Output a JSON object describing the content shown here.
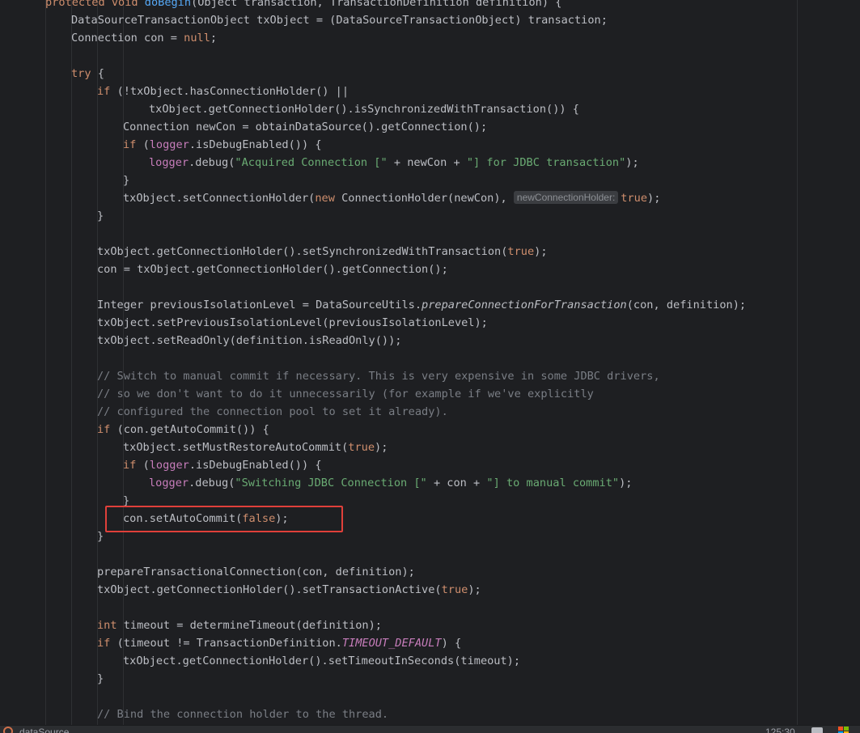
{
  "editor": {
    "lines": [
      [
        [
          "kw",
          "protected "
        ],
        [
          "kw",
          "void "
        ],
        [
          "method",
          "doBegin"
        ],
        [
          "plain",
          "(Object transaction, TransactionDefinition definition) {"
        ]
      ],
      [
        [
          "plain",
          "DataSourceTransactionObject txObject = (DataSourceTransactionObject) transaction;"
        ]
      ],
      [
        [
          "plain",
          "Connection con = "
        ],
        [
          "kw",
          "null"
        ],
        [
          "plain",
          ";"
        ]
      ],
      [],
      [
        [
          "kw",
          "try "
        ],
        [
          "plain",
          "{"
        ]
      ],
      [
        [
          "kw",
          "if "
        ],
        [
          "plain",
          "(!txObject.hasConnectionHolder() ||"
        ]
      ],
      [
        [
          "plain",
          "txObject.getConnectionHolder().isSynchronizedWithTransaction()) {"
        ]
      ],
      [
        [
          "plain",
          "Connection newCon = obtainDataSource().getConnection();"
        ]
      ],
      [
        [
          "kw",
          "if "
        ],
        [
          "plain",
          "("
        ],
        [
          "field",
          "logger"
        ],
        [
          "plain",
          ".isDebugEnabled()) {"
        ]
      ],
      [
        [
          "field",
          "logger"
        ],
        [
          "plain",
          ".debug("
        ],
        [
          "str",
          "\"Acquired Connection [\" "
        ],
        [
          "plain",
          "+ newCon + "
        ],
        [
          "str",
          "\"] for JDBC transaction\""
        ],
        [
          "plain",
          ");"
        ]
      ],
      [
        [
          "plain",
          "}"
        ]
      ],
      [
        [
          "plain",
          "txObject.setConnectionHolder("
        ],
        [
          "kw",
          "new "
        ],
        [
          "plain",
          "ConnectionHolder(newCon), "
        ],
        [
          "hint",
          "newConnectionHolder:"
        ],
        [
          "kw",
          "true"
        ],
        [
          "plain",
          ");"
        ]
      ],
      [
        [
          "plain",
          "}"
        ]
      ],
      [],
      [
        [
          "plain",
          "txObject.getConnectionHolder().setSynchronizedWithTransaction("
        ],
        [
          "kw",
          "true"
        ],
        [
          "plain",
          ");"
        ]
      ],
      [
        [
          "plain",
          "con = txObject.getConnectionHolder().getConnection();"
        ]
      ],
      [],
      [
        [
          "plain",
          "Integer previousIsolationLevel = DataSourceUtils."
        ],
        [
          "italic",
          "prepareConnectionForTransaction"
        ],
        [
          "plain",
          "(con, definition);"
        ]
      ],
      [
        [
          "plain",
          "txObject.setPreviousIsolationLevel(previousIsolationLevel);"
        ]
      ],
      [
        [
          "plain",
          "txObject.setReadOnly(definition.isReadOnly());"
        ]
      ],
      [],
      [
        [
          "cmt",
          "// Switch to manual commit if necessary. This is very expensive in some JDBC drivers,"
        ]
      ],
      [
        [
          "cmt",
          "// so we don't want to do it unnecessarily (for example if we've explicitly"
        ]
      ],
      [
        [
          "cmt",
          "// configured the connection pool to set it already)."
        ]
      ],
      [
        [
          "kw",
          "if "
        ],
        [
          "plain",
          "(con.getAutoCommit()) {"
        ]
      ],
      [
        [
          "plain",
          "txObject.setMustRestoreAutoCommit("
        ],
        [
          "kw",
          "true"
        ],
        [
          "plain",
          ");"
        ]
      ],
      [
        [
          "kw",
          "if "
        ],
        [
          "plain",
          "("
        ],
        [
          "field",
          "logger"
        ],
        [
          "plain",
          ".isDebugEnabled()) {"
        ]
      ],
      [
        [
          "field",
          "logger"
        ],
        [
          "plain",
          ".debug("
        ],
        [
          "str",
          "\"Switching JDBC Connection [\" "
        ],
        [
          "plain",
          "+ con + "
        ],
        [
          "str",
          "\"] to manual commit\""
        ],
        [
          "plain",
          ");"
        ]
      ],
      [
        [
          "plain",
          "}"
        ]
      ],
      [
        [
          "plain",
          "con.setAutoCommit("
        ],
        [
          "kw",
          "false"
        ],
        [
          "plain",
          ");"
        ]
      ],
      [
        [
          "plain",
          "}"
        ]
      ],
      [],
      [
        [
          "plain",
          "prepareTransactionalConnection(con, definition);"
        ]
      ],
      [
        [
          "plain",
          "txObject.getConnectionHolder().setTransactionActive("
        ],
        [
          "kw",
          "true"
        ],
        [
          "plain",
          ");"
        ]
      ],
      [],
      [
        [
          "kw",
          "int "
        ],
        [
          "plain",
          "timeout = determineTimeout(definition);"
        ]
      ],
      [
        [
          "kw",
          "if "
        ],
        [
          "plain",
          "(timeout != TransactionDefinition."
        ],
        [
          "const",
          "TIMEOUT_DEFAULT"
        ],
        [
          "plain",
          ") {"
        ]
      ],
      [
        [
          "plain",
          "txObject.getConnectionHolder().setTimeoutInSeconds(timeout);"
        ]
      ],
      [
        [
          "plain",
          "}"
        ]
      ],
      [],
      [
        [
          "cmt",
          "// Bind the connection holder to the thread."
        ]
      ]
    ]
  },
  "status": {
    "datasource_label": "dataSource",
    "position": "125:30"
  },
  "icons": {
    "datasource": "database-icon",
    "lock": "lock-icon",
    "windows": "windows-icon"
  },
  "colors": {
    "background": "#1e1f22",
    "keyword": "#cf8e6d",
    "method_declaration": "#56a8f5",
    "field": "#c77dbb",
    "string": "#6aab73",
    "comment": "#7a7e85",
    "highlight_border": "#e0403a"
  }
}
